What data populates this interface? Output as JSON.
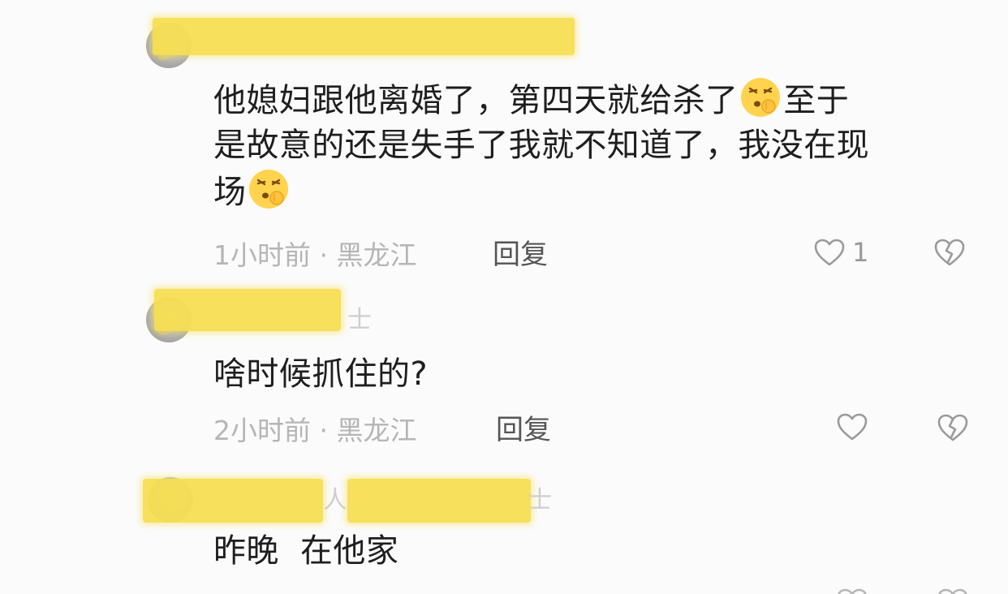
{
  "comments": [
    {
      "text_part1": "他媳妇跟他离婚了，第四天就给杀了",
      "text_part2": "至于",
      "text_line2": "是故意的还是失手了我就不知道了，我没在现",
      "text_line3": "场",
      "emoji_icon": "shushing-face-icon",
      "time": "1小时前",
      "separator": "·",
      "location": "黑龙江",
      "reply_label": "回复",
      "like_count": "1"
    },
    {
      "name_suffix": "士",
      "text": "啥时候抓住的?",
      "time": "2小时前",
      "separator": "·",
      "location": "黑龙江",
      "reply_label": "回复",
      "like_count": ""
    },
    {
      "name_suffix_a": "人",
      "name_suffix_b": "士",
      "text": "昨晚  在他家"
    }
  ],
  "colors": {
    "text": "#1e1e1e",
    "meta": "#b5b5b5",
    "reply": "#555555",
    "redaction": "#f6df54",
    "icon": "#9a9a9a"
  }
}
